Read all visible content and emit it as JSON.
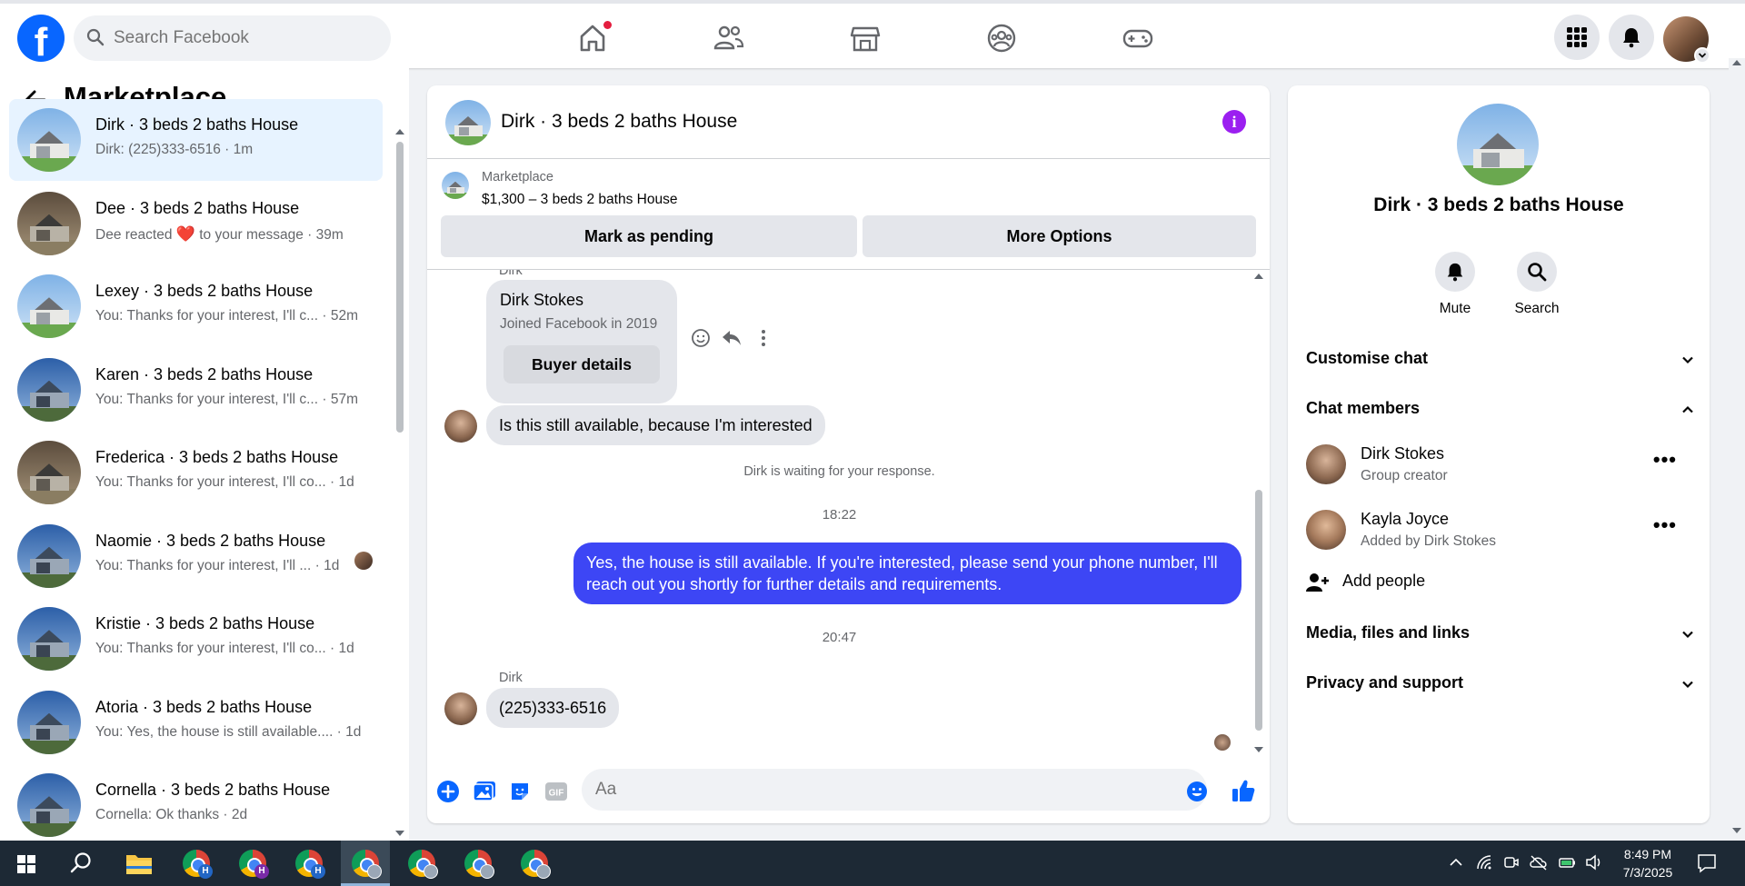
{
  "topbar": {
    "logo": "f",
    "search_placeholder": "Search Facebook",
    "nav_icons": [
      "home-icon",
      "friends-icon",
      "marketplace-icon",
      "groups-icon",
      "gaming-icon"
    ],
    "right_icons": [
      "menu-grid-icon",
      "notifications-bell-icon",
      "profile-avatar"
    ]
  },
  "marketplace": {
    "title": "Marketplace",
    "conversations": [
      {
        "name": "Dirk · 3 beds 2 baths House",
        "sub": "Dirk: (225)333-6516 · 1m",
        "active": true,
        "theme": "light"
      },
      {
        "name": "Dee · 3 beds 2 baths House",
        "sub_prefix": "Dee reacted",
        "sub_emoji": "❤️",
        "sub_suffix": "to your message · 39m",
        "theme": "dark"
      },
      {
        "name": "Lexey · 3 beds 2 baths House",
        "sub": "You: Thanks for your interest, I'll c... · 52m",
        "theme": "light"
      },
      {
        "name": "Karen · 3 beds 2 baths House",
        "sub": "You: Thanks for your interest, I'll c... · 57m",
        "theme": "blue"
      },
      {
        "name": "Frederica · 3 beds 2 baths House",
        "sub": "You: Thanks for your interest, I'll co... · 1d",
        "theme": "dark"
      },
      {
        "name": "Naomie · 3 beds 2 baths House",
        "sub": "You: Thanks for your interest, I'll ... · 1d",
        "theme": "blue",
        "seen_avatar": true
      },
      {
        "name": "Kristie · 3 beds 2 baths House",
        "sub": "You: Thanks for your interest, I'll co... · 1d",
        "theme": "blue"
      },
      {
        "name": "Atoria · 3 beds 2 baths House",
        "sub": "You: Yes, the house is still available.... · 1d",
        "theme": "blue"
      },
      {
        "name": "Cornella · 3 beds 2 baths House",
        "sub": "Cornella: Ok thanks · 2d",
        "theme": "blue"
      }
    ]
  },
  "chat": {
    "title": "Dirk · 3 beds 2 baths House",
    "listing_source": "Marketplace",
    "listing_desc": "$1,300 – 3 beds 2 baths House",
    "mark_pending_label": "Mark as pending",
    "more_options_label": "More Options",
    "sender_top": "Dirk",
    "card_name": "Dirk Stokes",
    "card_joined": "Joined Facebook in 2019",
    "buyer_details_label": "Buyer details",
    "msg_in_1": "Is this still available, because I'm interested",
    "waiting_notice": "Dirk is waiting for your response.",
    "time_1": "18:22",
    "msg_out_1": "Yes, the house is still available. If you're interested, please send your phone number, I'll reach out you shortly for further details and requirements.",
    "time_2": "20:47",
    "sender_bottom": "Dirk",
    "msg_in_2": "(225)333-6516",
    "composer_placeholder": "Aa"
  },
  "details": {
    "title": "Dirk · 3 beds 2 baths House",
    "mute_label": "Mute",
    "search_label": "Search",
    "customise_chat": "Customise chat",
    "chat_members": "Chat members",
    "members": [
      {
        "name": "Dirk Stokes",
        "role": "Group creator"
      },
      {
        "name": "Kayla Joyce",
        "role": "Added by Dirk Stokes"
      }
    ],
    "add_people": "Add people",
    "media_files": "Media, files and links",
    "privacy_support": "Privacy and support"
  },
  "taskbar": {
    "time": "8:49 PM",
    "date": "7/3/2025",
    "chrome_badges": [
      "H",
      "H",
      "H",
      "",
      "",
      "",
      ""
    ]
  },
  "colors": {
    "facebook_blue": "#0866ff",
    "outgoing_bubble": "#3d46f5",
    "info_purple": "#9b1ff0",
    "active_row": "#e7f3ff"
  }
}
